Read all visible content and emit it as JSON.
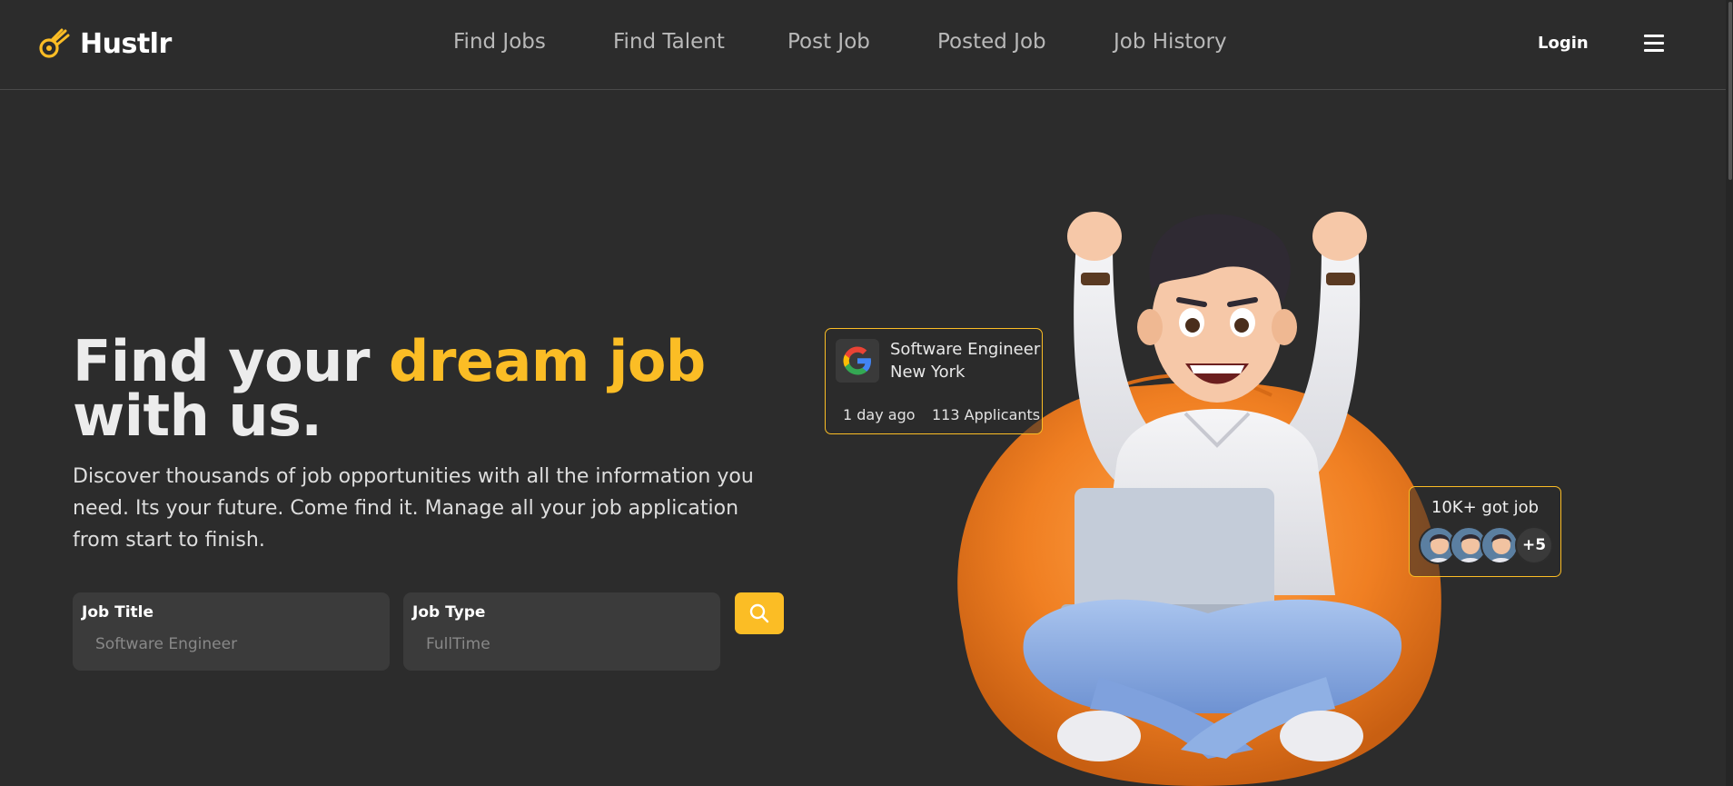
{
  "brand": {
    "name": "Hustlr",
    "accent": "#fbbd25",
    "icon": "comet-logo-icon"
  },
  "nav": {
    "items": [
      {
        "label": "Find Jobs"
      },
      {
        "label": "Find Talent"
      },
      {
        "label": "Post Job"
      },
      {
        "label": "Posted Job"
      },
      {
        "label": "Job History"
      }
    ],
    "login_label": "Login",
    "menu_icon": "hamburger-menu-icon"
  },
  "hero": {
    "headline_part1": "Find your ",
    "headline_accent": "dream job",
    "headline_part2": " with us.",
    "description": "Discover thousands of job opportunities with all the information you need. Its your future. Come find it. Manage all your job application from start to finish."
  },
  "search": {
    "job_title": {
      "label": "Job Title",
      "placeholder": "Software Engineer",
      "value": ""
    },
    "job_type": {
      "label": "Job Type",
      "placeholder": "FullTime",
      "value": ""
    },
    "button_icon": "search-icon"
  },
  "job_card": {
    "company_icon": "google-logo-icon",
    "title": "Software Engineer",
    "location": "New York",
    "posted": "1 day ago",
    "applicants": "113 Applicants"
  },
  "stat_card": {
    "text": "10K+ got job",
    "more_count": "+5"
  },
  "colors": {
    "background": "#2c2c2c",
    "accent": "#fbbd25",
    "field_bg": "#3b3b3b"
  }
}
